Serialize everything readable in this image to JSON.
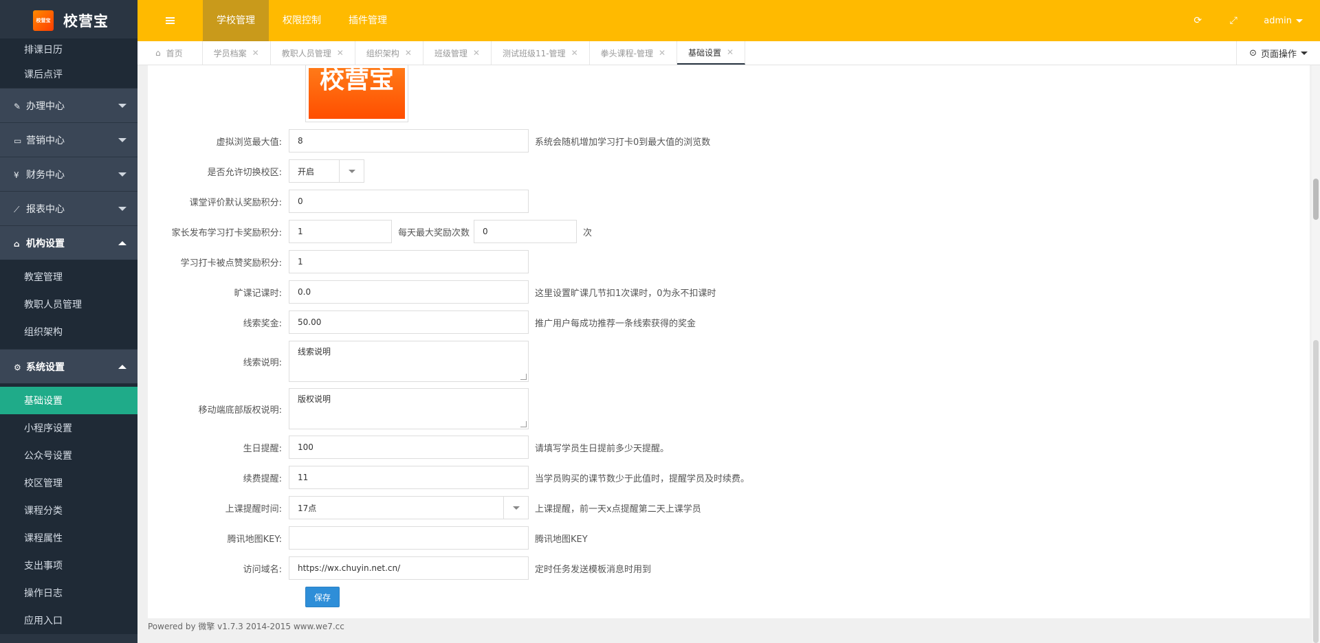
{
  "app": {
    "logo_mark": "校营宝",
    "name": "校营宝"
  },
  "sidebar": {
    "top_items": [
      {
        "label": "排课日历"
      },
      {
        "label": "课后点评"
      }
    ],
    "groups": [
      {
        "icon": "edit-icon",
        "glyph": "✎",
        "label": "办理中心"
      },
      {
        "icon": "laptop-icon",
        "glyph": "▭",
        "label": "营销中心"
      },
      {
        "icon": "yen-icon",
        "glyph": "¥",
        "label": "财务中心"
      },
      {
        "icon": "line-chart-icon",
        "glyph": "⟋",
        "label": "报表中心"
      },
      {
        "icon": "bank-icon",
        "glyph": "⌂",
        "label": "机构设置"
      },
      {
        "icon": "gears-icon",
        "glyph": "⚙",
        "label": "系统设置"
      }
    ],
    "org_items": [
      {
        "label": "教室管理"
      },
      {
        "label": "教职人员管理"
      },
      {
        "label": "组织架构"
      }
    ],
    "system_items": [
      {
        "label": "基础设置"
      },
      {
        "label": "小程序设置"
      },
      {
        "label": "公众号设置"
      },
      {
        "label": "校区管理"
      },
      {
        "label": "课程分类"
      },
      {
        "label": "课程属性"
      },
      {
        "label": "支出事项"
      },
      {
        "label": "操作日志"
      },
      {
        "label": "应用入口"
      }
    ]
  },
  "topbar": {
    "tabs": [
      {
        "label": "学校管理"
      },
      {
        "label": "权限控制"
      },
      {
        "label": "插件管理"
      }
    ],
    "user": "admin"
  },
  "page_tabs": {
    "home": "首页",
    "tabs": [
      {
        "label": "学员档案"
      },
      {
        "label": "教职人员管理"
      },
      {
        "label": "组织架构"
      },
      {
        "label": "班级管理"
      },
      {
        "label": "测试班级11-管理"
      },
      {
        "label": "拳头课程-管理"
      },
      {
        "label": "基础设置"
      }
    ],
    "ops": "页面操作"
  },
  "form": {
    "logo_preview_text": "校营宝",
    "virtual_views": {
      "label": "虚拟浏览最大值:",
      "value": "8",
      "help": "系统会随机增加学习打卡0到最大值的浏览数"
    },
    "switch_campus": {
      "label": "是否允许切换校区:",
      "value": "开启"
    },
    "class_eval_points": {
      "label": "课堂评价默认奖励积分:",
      "value": "0"
    },
    "parent_checkin_points": {
      "label": "家长发布学习打卡奖励积分:",
      "value": "1",
      "daily_label": "每天最大奖励次数",
      "daily_value": "0",
      "unit": "次"
    },
    "checkin_like_points": {
      "label": "学习打卡被点赞奖励积分:",
      "value": "1"
    },
    "absence_hours": {
      "label": "旷课记课时:",
      "value": "0.0",
      "help": "这里设置旷课几节扣1次课时，0为永不扣课时"
    },
    "lead_bonus": {
      "label": "线索奖金:",
      "value": "50.00",
      "help": "推广用户每成功推荐一条线索获得的奖金"
    },
    "lead_desc": {
      "label": "线索说明:",
      "value": "线索说明"
    },
    "copyright": {
      "label": "移动端底部版权说明:",
      "value": "版权说明"
    },
    "birthday_remind": {
      "label": "生日提醒:",
      "value": "100",
      "help": "请填写学员生日提前多少天提醒。"
    },
    "renew_remind": {
      "label": "续费提醒:",
      "value": "11",
      "help": "当学员购买的课节数少于此值时，提醒学员及时续费。"
    },
    "class_remind_time": {
      "label": "上课提醒时间:",
      "value": "17点",
      "help": "上课提醒，前一天x点提醒第二天上课学员"
    },
    "tencent_map_key": {
      "label": "腾讯地图KEY:",
      "value": "",
      "help": "腾讯地图KEY"
    },
    "visit_domain": {
      "label": "访问域名:",
      "value": "https://wx.chuyin.net.cn/",
      "help": "定时任务发送模板消息时用到"
    },
    "save_label": "保存"
  },
  "footer": "Powered by 微擎 v1.7.3 2014-2015 www.we7.cc",
  "colors": {
    "sidebar_bg": "#2a3542",
    "topbar_bg": "#ffba00",
    "active_menu": "#1fab89",
    "save_button": "#2e8ed8"
  }
}
